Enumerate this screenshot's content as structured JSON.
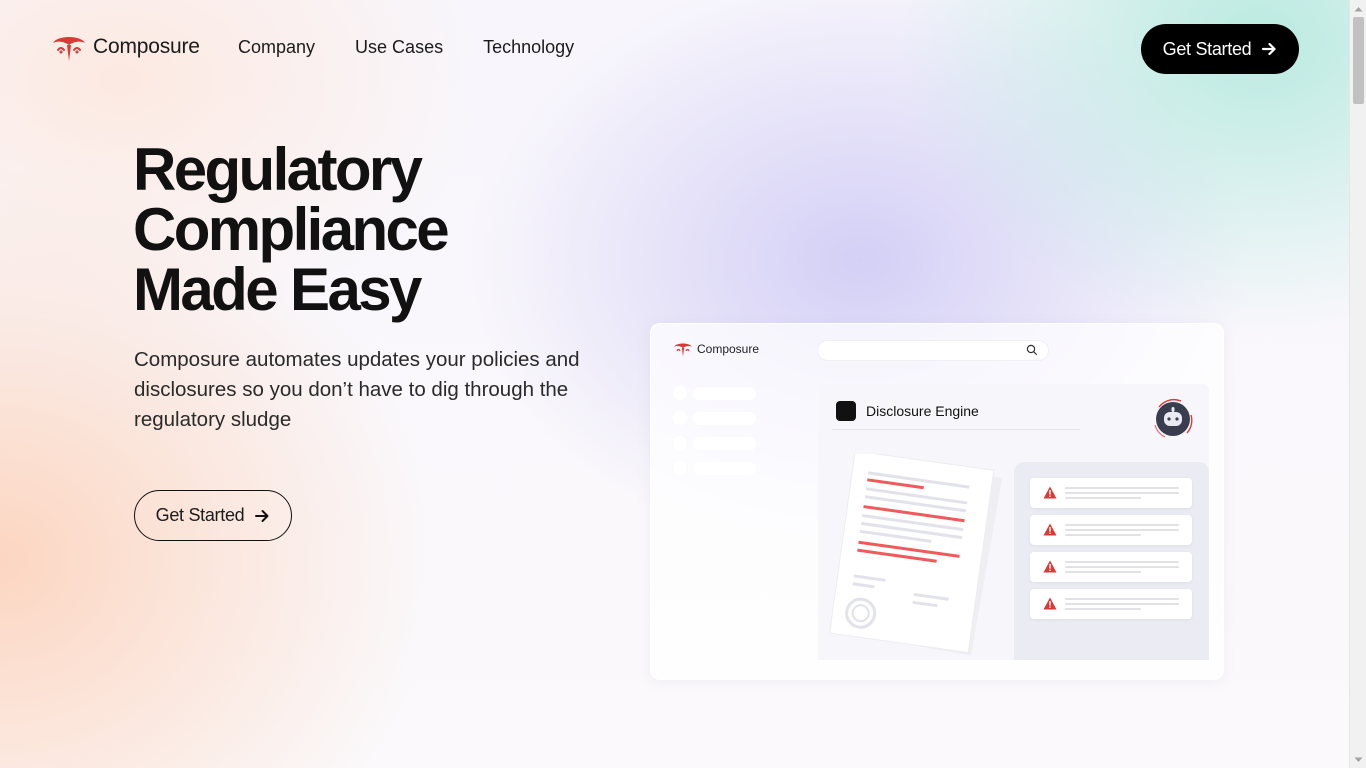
{
  "brand": {
    "name": "Composure",
    "accent": "#d93a35"
  },
  "nav": {
    "links": [
      "Company",
      "Use Cases",
      "Technology"
    ],
    "cta_label": "Get Started"
  },
  "hero": {
    "title_lines": [
      "Regulatory",
      "Compliance",
      "Made Easy"
    ],
    "subtitle": "Composure automates updates your policies and disclosures  so you don’t have to dig through the regulatory sludge",
    "cta_label": "Get Started"
  },
  "mockup": {
    "brand_name": "Composure",
    "panel_title": "Disclosure Engine",
    "alert_color": "#d93a35",
    "alert_count": 4,
    "sidebar_item_count": 4
  },
  "icons": [
    "composure-logo-icon",
    "arrow-right-icon",
    "search-icon",
    "warning-icon",
    "robot-avatar-icon",
    "document-icon"
  ]
}
